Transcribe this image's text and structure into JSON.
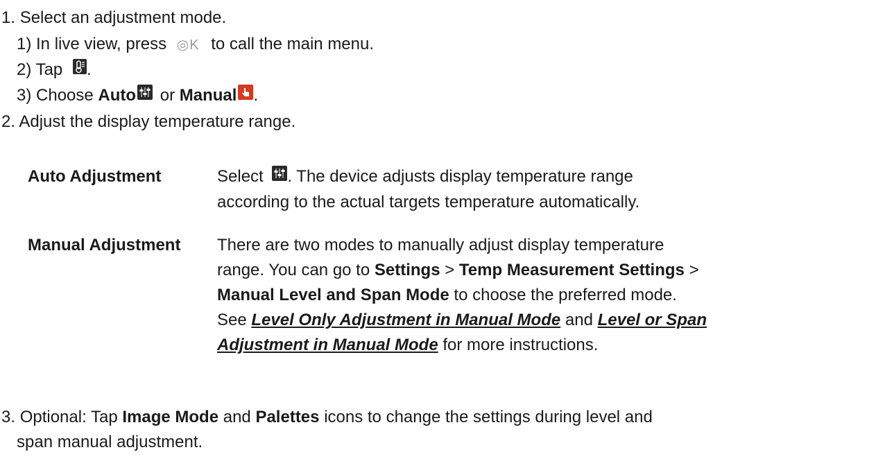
{
  "steps": {
    "s1": {
      "num": "1.",
      "text": "Select an adjustment mode."
    },
    "s1_1": {
      "prefix": "1) In live view, press",
      "key": "◎K",
      "suffix": "to call the main menu."
    },
    "s1_2": {
      "prefix": "2) Tap",
      "suffix": "."
    },
    "s1_3": {
      "prefix": "3) Choose",
      "auto": "Auto",
      "or": "or",
      "manual": "Manual",
      "suffix": "."
    },
    "s2": {
      "num": "2.",
      "text": "Adjust the display temperature range."
    },
    "s3": {
      "num": "3.",
      "line1_a": "Optional: Tap",
      "image_mode": "Image Mode",
      "and": "and",
      "palettes": "Palettes",
      "line1_b": "icons to change the settings during level and",
      "line2": "span manual adjustment."
    }
  },
  "table": {
    "auto": {
      "label": "Auto Adjustment",
      "select": "Select",
      "line1": ". The device adjusts display temperature range",
      "line2": "according to the actual targets temperature automatically."
    },
    "manual": {
      "label": "Manual Adjustment",
      "line1": "There are two modes to manually adjust display temperature",
      "line2_a": "range. You can go to",
      "settings": "Settings",
      "gt": ">",
      "temp": "Temp Measurement Settings",
      "gt2": ">",
      "level_span": "Manual Level and Span Mode",
      "line3_b": "to choose the preferred mode.",
      "see": "See",
      "link1": "Level Only Adjustment in Manual Mode",
      "and": "and",
      "link2_a": "Level or Span",
      "link2_b": "Adjustment in Manual Mode",
      "line5_b": "for more instructions."
    }
  },
  "icons": {
    "ok_key": "ok-button-icon",
    "thermometer": "temperature-icon",
    "auto": "auto-adjust-icon",
    "manual": "manual-adjust-icon"
  },
  "colors": {
    "icon_dark": "#2a2a2a",
    "icon_red": "#d43a1f"
  }
}
